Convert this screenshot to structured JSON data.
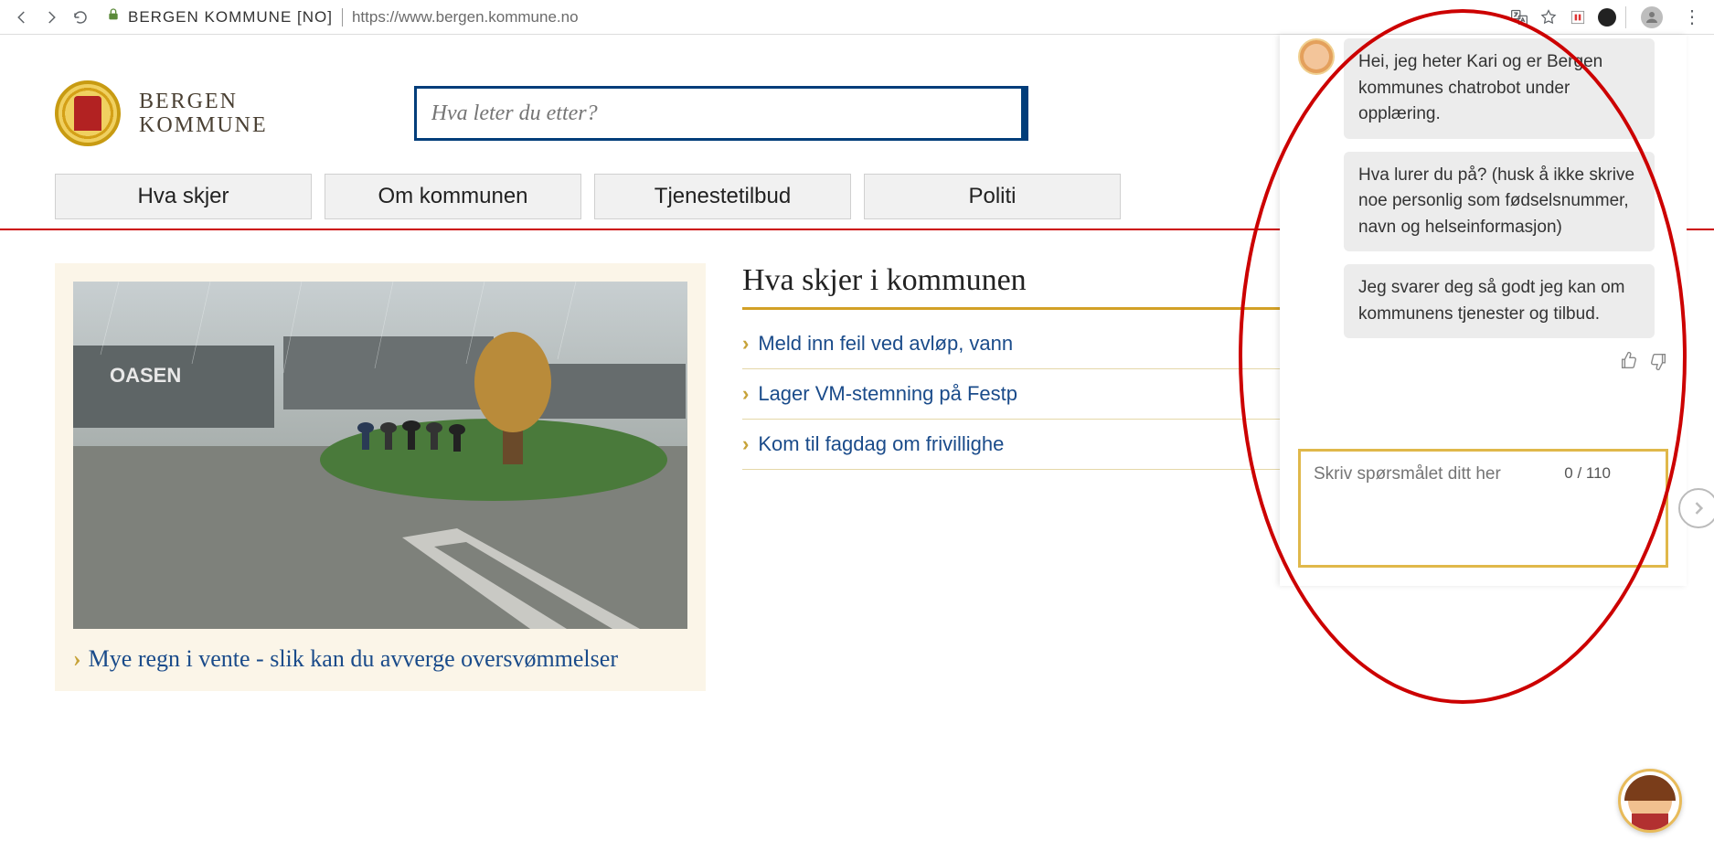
{
  "browser": {
    "site_label": "BERGEN KOMMUNE [NO]",
    "url": "https://www.bergen.kommune.no"
  },
  "header": {
    "logo_line1": "BERGEN",
    "logo_line2": "KOMMUNE",
    "search_placeholder": "Hva leter du etter?"
  },
  "nav": {
    "items": [
      "Hva skjer",
      "Om kommunen",
      "Tjenestetilbud",
      "Politi"
    ]
  },
  "hero": {
    "link_text": "Mye regn i vente - slik kan du avverge oversvømmelser"
  },
  "sidebar": {
    "title": "Hva skjer i kommunen",
    "links": [
      "Meld inn feil ved avløp, vann",
      "Lager VM-stemning på Festp",
      "Kom til fagdag om frivillighe"
    ]
  },
  "chat": {
    "messages": [
      "Hei, jeg heter Kari og er Bergen kommunes chatrobot under opplæring.",
      "Hva lurer du på? (husk å ikke skrive noe personlig som fødselsnummer, navn og helseinformasjon)",
      "Jeg svarer deg så godt jeg kan om kommunens tjenester og tilbud."
    ],
    "input_placeholder": "Skriv spørsmålet ditt her",
    "char_count": "0 / 110"
  }
}
